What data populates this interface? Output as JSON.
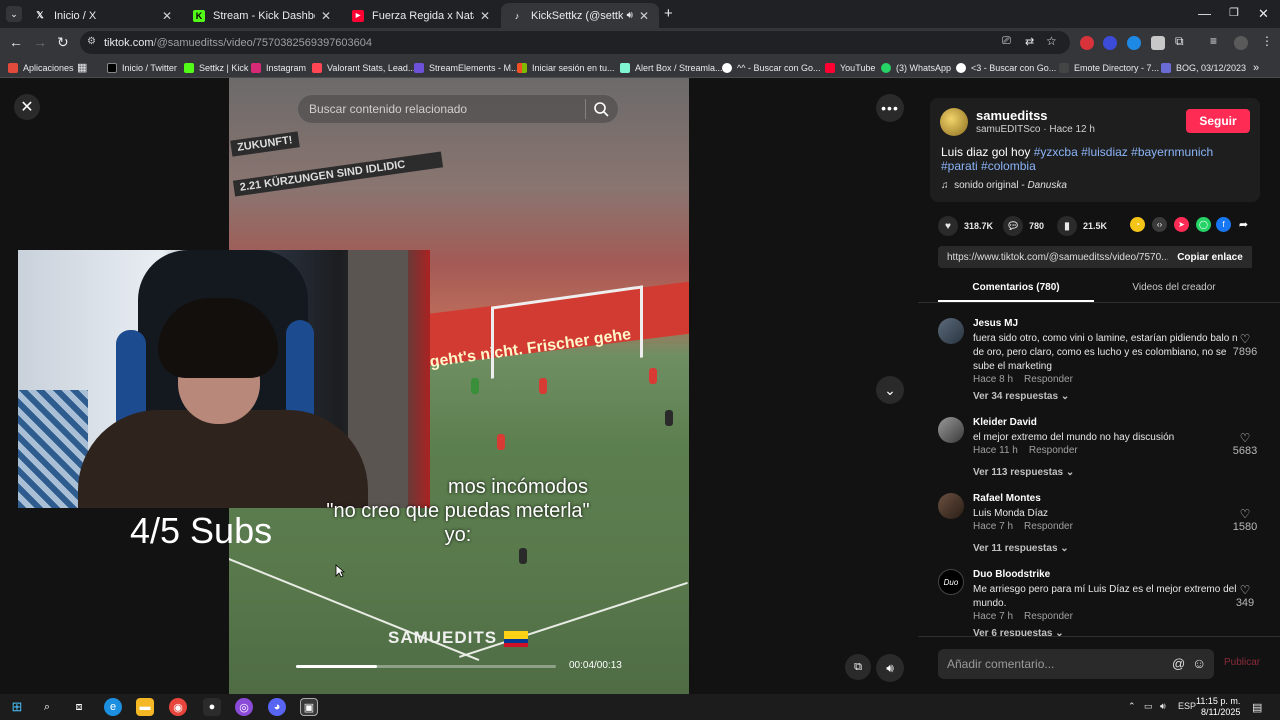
{
  "browser": {
    "tabs": [
      {
        "title": "Inicio / X",
        "icon": "x-logo-icon"
      },
      {
        "title": "Stream - Kick Dashboard",
        "icon": "kick-icon"
      },
      {
        "title": "Fuerza Regida x Natanael Cano",
        "icon": "youtube-icon"
      },
      {
        "title": "KickSettkz (@settkz_kick) | TikTok",
        "icon": "tiktok-icon"
      }
    ],
    "url_host": "tiktok.com",
    "url_path": "/@samueditss/video/7570382569397603604",
    "bookmarks": [
      "Aplicaciones",
      "Inicio / Twitter",
      "Settkz | Kick",
      "Instagram",
      "Valorant Stats, Lead...",
      "StreamElements - M...",
      "Iniciar sesión en tu...",
      "Alert Box / Streamla...",
      "^^ - Buscar con Go...",
      "YouTube",
      "(3) WhatsApp",
      "<3 - Buscar con Go...",
      "Emote Directory - 7...",
      "BOG, 03/12/2023"
    ]
  },
  "video": {
    "search_placeholder": "Buscar contenido relacionado",
    "caption_line1": "mos incómodos",
    "caption_line2": "\"no creo que puedas meterla\"",
    "caption_line3": "yo:",
    "watermark": "SAMUEDITS",
    "subs_overlay": "4/5 Subs",
    "time": "00:04/00:13",
    "progress": 0.31,
    "banner1": "ZUKUNFT!",
    "banner2": "2.21 KÜRZUNGEN SIND IDLIDIC",
    "ad_text": "geht's nicht. Frischer gehe",
    "colors": {
      "accent": "#fe2c55"
    }
  },
  "author": {
    "username": "samueditss",
    "subline": "samuEDITSco · Hace 12 h",
    "follow_label": "Seguir",
    "description_text": "Luis diaz gol hoy",
    "hashtags": [
      "#yzxcba",
      "#luisdiaz",
      "#bayernmunich",
      "#parati",
      "#colombia"
    ],
    "sound": "sonido original - ",
    "sound_author": "Danuska"
  },
  "stats": {
    "likes": "318.7K",
    "comments": "780",
    "saves": "21.5K"
  },
  "link": {
    "url": "https://www.tiktok.com/@samueditss/video/7570...",
    "copy_label": "Copiar enlace"
  },
  "panel_tabs": {
    "comments": "Comentarios (780)",
    "videos": "Videos del creador"
  },
  "comments": [
    {
      "user": "Jesus MJ",
      "text": "fuera sido otro, como vini o lamine, estarían pidiendo balo n de oro, pero claro, como es lucho y es colombiano, no se sube el marketing",
      "time": "Hace 8 h",
      "reply": "Responder",
      "replies": "Ver 34 respuestas",
      "likes": "7896"
    },
    {
      "user": "Kleider David",
      "text": "el mejor extremo del mundo no hay discusión",
      "time": "Hace 11 h",
      "reply": "Responder",
      "replies": "Ver 113 respuestas",
      "likes": "5683"
    },
    {
      "user": "Rafael Montes",
      "text": "Luis Monda Díaz",
      "time": "Hace 7 h",
      "reply": "Responder",
      "replies": "Ver 11 respuestas",
      "likes": "1580"
    },
    {
      "user": "Duo Bloodstrike",
      "text": "Me arriesgo pero para mí Luis Díaz es el mejor extremo del mundo.",
      "time": "Hace 7 h",
      "reply": "Responder",
      "replies": "Ver 6 respuestas",
      "likes": "349"
    }
  ],
  "comment_box": {
    "placeholder": "Añadir comentario...",
    "publish": "Publicar"
  },
  "taskbar": {
    "lang": "ESP",
    "time": "11:15 p. m.",
    "date": "8/11/2025"
  }
}
